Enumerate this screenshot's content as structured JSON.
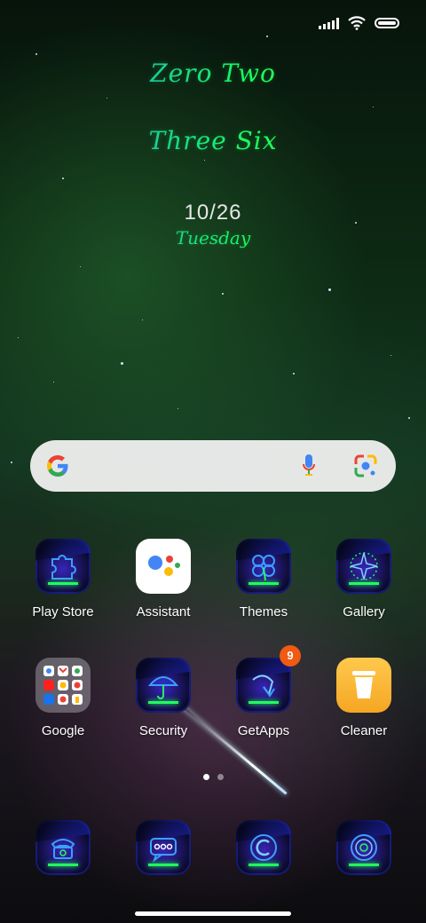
{
  "status_bar": {
    "signal_icon": "signal-icon",
    "wifi_icon": "wifi-icon",
    "battery_icon": "battery-icon"
  },
  "clock_widget": {
    "hours": "Zero Two",
    "minutes": "Three Six",
    "date": "10/26",
    "weekday": "Tuesday"
  },
  "search_bar": {
    "logo": "google-g-icon",
    "mic": "mic-icon",
    "lens": "lens-icon"
  },
  "apps_row1": [
    {
      "label": "Play Store",
      "icon": "puzzle-icon"
    },
    {
      "label": "Assistant",
      "icon": "assistant-icon"
    },
    {
      "label": "Themes",
      "icon": "clover-icon"
    },
    {
      "label": "Gallery",
      "icon": "compass-star-icon"
    }
  ],
  "apps_row2": [
    {
      "label": "Google",
      "icon": "google-folder-icon"
    },
    {
      "label": "Security",
      "icon": "umbrella-icon"
    },
    {
      "label": "GetApps",
      "icon": "getapps-icon",
      "badge": "9"
    },
    {
      "label": "Cleaner",
      "icon": "trash-icon"
    }
  ],
  "dock": [
    {
      "icon": "phone-icon"
    },
    {
      "icon": "messages-icon"
    },
    {
      "icon": "browser-icon"
    },
    {
      "icon": "camera-icon"
    }
  ],
  "page_indicator": {
    "pages": 2,
    "current": 1
  },
  "colors": {
    "neon_green": "#21ff5a",
    "neon_blue": "#1a7bff",
    "badge": "#f05a12"
  }
}
